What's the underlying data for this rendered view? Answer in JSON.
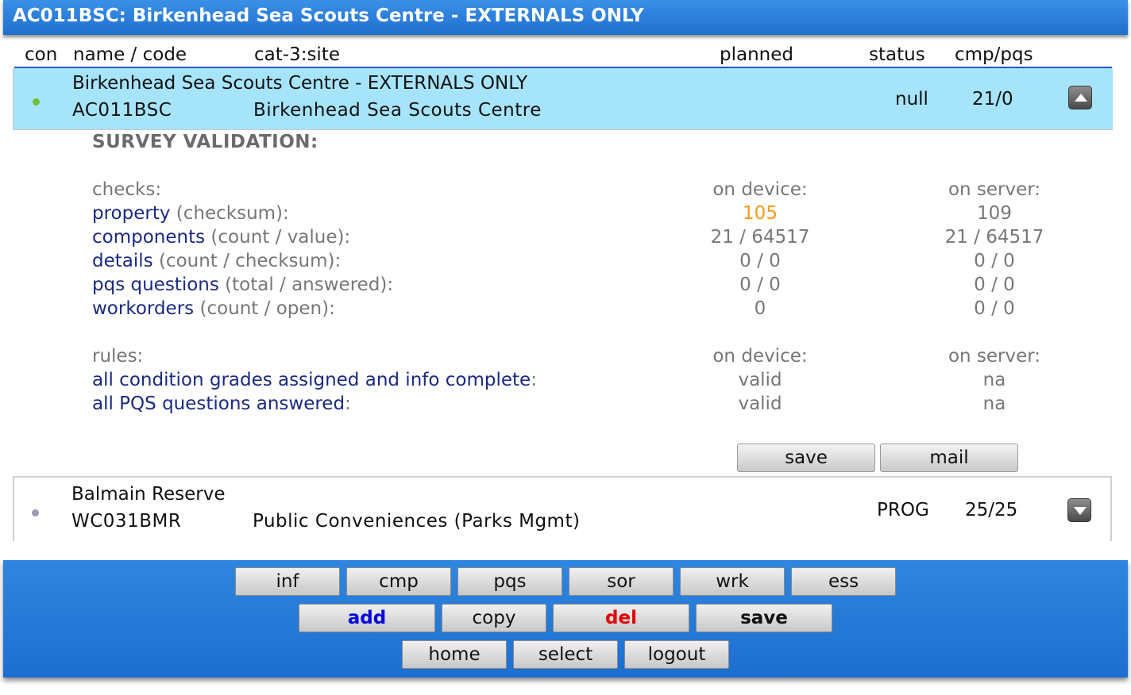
{
  "title": "AC011BSC: Birkenhead Sea Scouts Centre - EXTERNALS ONLY",
  "columns": {
    "con": "con",
    "name_code": "name / code",
    "cat": "cat-3:site",
    "planned": "planned",
    "status": "status",
    "cmp_pqs": "cmp/pqs"
  },
  "rows": [
    {
      "name": "Birkenhead Sea Scouts Centre - EXTERNALS ONLY",
      "code": "AC011BSC",
      "site": "Birkenhead Sea Scouts Centre",
      "status": "null",
      "cmp_pqs": "21/0",
      "dot_color": "#6abf3a",
      "expanded": true
    },
    {
      "name": "Balmain Reserve",
      "code": "WC031BMR",
      "site": "Public Conveniences (Parks Mgmt)",
      "status": "PROG",
      "cmp_pqs": "25/25",
      "dot_color": "#9a9ab4",
      "expanded": false
    }
  ],
  "validation": {
    "heading": "SURVEY VALIDATION:",
    "checks_label": "checks:",
    "on_device": "on device:",
    "on_server": "on server:",
    "checks": [
      {
        "key": "property",
        "detail": " (checksum):",
        "device": "105",
        "server": "109"
      },
      {
        "key": "components",
        "detail": " (count / value):",
        "device": "21 / 64517",
        "server": "21 / 64517"
      },
      {
        "key": "details",
        "detail": " (count / checksum):",
        "device": "0 / 0",
        "server": "0 / 0"
      },
      {
        "key": "pqs questions",
        "detail": " (total / answered):",
        "device": "0 / 0",
        "server": "0 / 0"
      },
      {
        "key": "workorders",
        "detail": " (count / open):",
        "device": "0",
        "server": "0 / 0"
      }
    ],
    "rules_label": "rules:",
    "rules": [
      {
        "key": "all condition grades assigned and info complete",
        "detail": ":",
        "device": "valid",
        "server": "na"
      },
      {
        "key": "all PQS questions answered",
        "detail": ":",
        "device": "valid",
        "server": "na"
      }
    ],
    "save_label": "save",
    "mail_label": "mail"
  },
  "toolbar": {
    "row1": [
      "inf",
      "cmp",
      "pqs",
      "sor",
      "wrk",
      "ess"
    ],
    "add": "add",
    "copy": "copy",
    "del": "del",
    "save": "save",
    "home": "home",
    "select": "select",
    "logout": "logout"
  },
  "colors": {
    "header_blue": "#2277d8",
    "selected_row": "#a6e4fb",
    "add_color": "#0000dd",
    "del_color": "#e00000",
    "mismatch": "#f59a1a"
  }
}
